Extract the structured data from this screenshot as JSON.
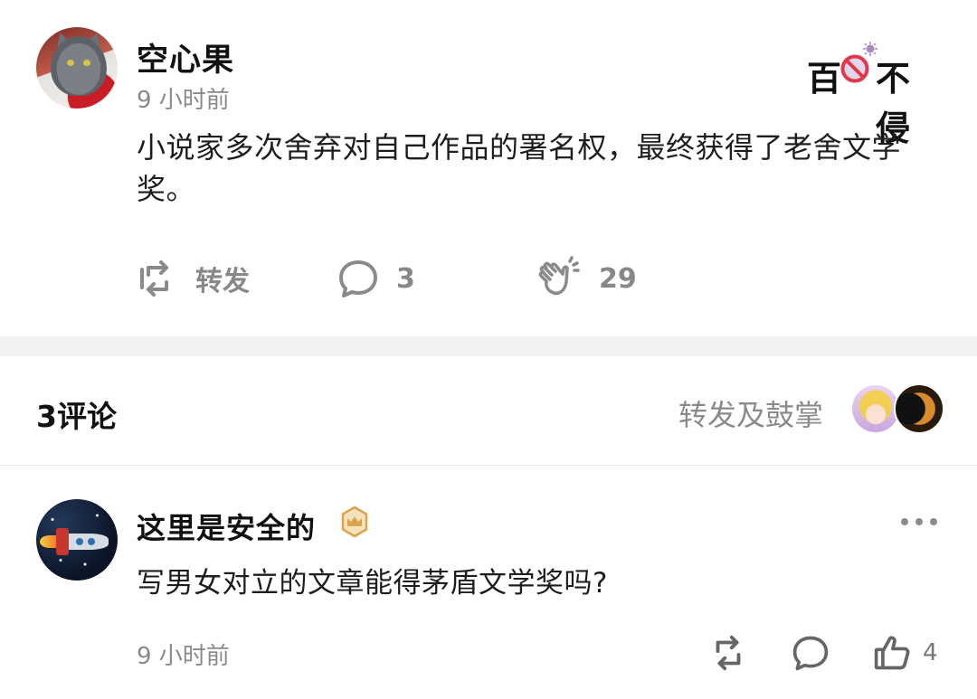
{
  "post": {
    "author": "空心果",
    "time": "9 小时前",
    "brand": {
      "left": "百",
      "right": "不侵"
    },
    "text": "小说家多次舍弃对自己作品的署名权，最终获得了老舍文学奖。",
    "actions": {
      "repost_label": "转发",
      "comment_count": "3",
      "clap_count": "29"
    }
  },
  "comments_header": {
    "count_label": "3评论",
    "repost_clap_label": "转发及鼓掌"
  },
  "comment": {
    "author": "这里是安全的",
    "text": "写男女对立的文章能得茅盾文学奖吗?",
    "time": "9 小时前",
    "like_count": "4"
  },
  "colors": {
    "accent_gray": "#8a8a8a",
    "badge_gold": "#d9a44a",
    "ban_red": "#e0394a",
    "gap_bg": "#f2f2f2"
  }
}
